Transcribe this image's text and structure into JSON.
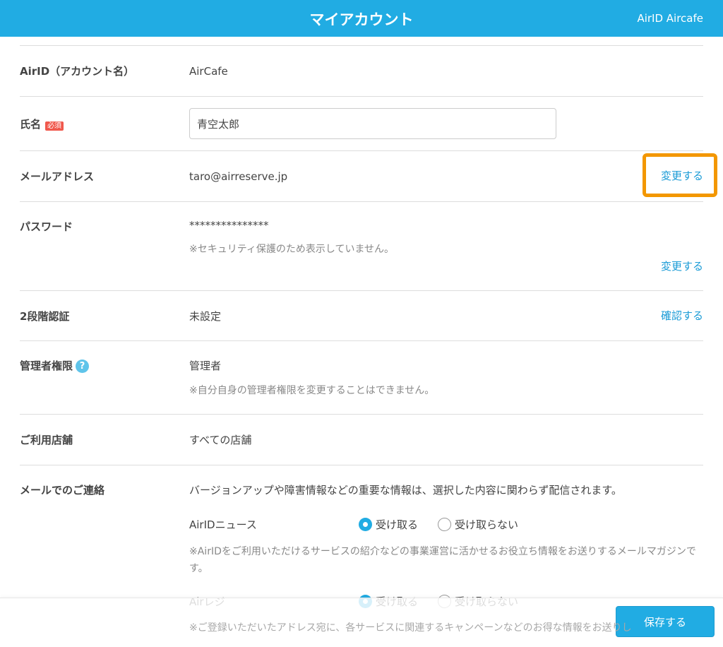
{
  "header": {
    "title": "マイアカウント",
    "account": "AirID Aircafe"
  },
  "rows": {
    "airid": {
      "label": "AirID（アカウント名）",
      "value": "AirCafe"
    },
    "name": {
      "label": "氏名",
      "badge": "必須",
      "value": "青空太郎"
    },
    "email": {
      "label": "メールアドレス",
      "value": "taro@airreserve.jp",
      "link": "変更する"
    },
    "password": {
      "label": "パスワード",
      "value": "***************",
      "note": "※セキュリティ保護のため表示していません。",
      "link": "変更する"
    },
    "twofactor": {
      "label": "2段階認証",
      "value": "未設定",
      "link": "確認する"
    },
    "admin": {
      "label": "管理者権限",
      "help": "?",
      "value": "管理者",
      "note": "※自分自身の管理者権限を変更することはできません。"
    },
    "stores": {
      "label": "ご利用店舗",
      "value": "すべての店舗"
    },
    "mail": {
      "label": "メールでのご連絡",
      "intro": "バージョンアップや障害情報などの重要な情報は、選択した内容に関わらず配信されます。",
      "items": [
        {
          "name": "AirIDニュース",
          "opt_yes": "受け取る",
          "opt_no": "受け取らない",
          "selected": "yes",
          "note": "※AirIDをご利用いただけるサービスの紹介などの事業運営に活かせるお役立ち情報をお送りするメールマガジンです。"
        },
        {
          "name": "Airレジ",
          "opt_yes": "受け取る",
          "opt_no": "受け取らない",
          "selected": "yes",
          "note": "※ご登録いただいたアドレス宛に、各サービスに関連するキャンペーンなどのお得な情報をお送りし"
        }
      ]
    }
  },
  "footer": {
    "save": "保存する"
  }
}
